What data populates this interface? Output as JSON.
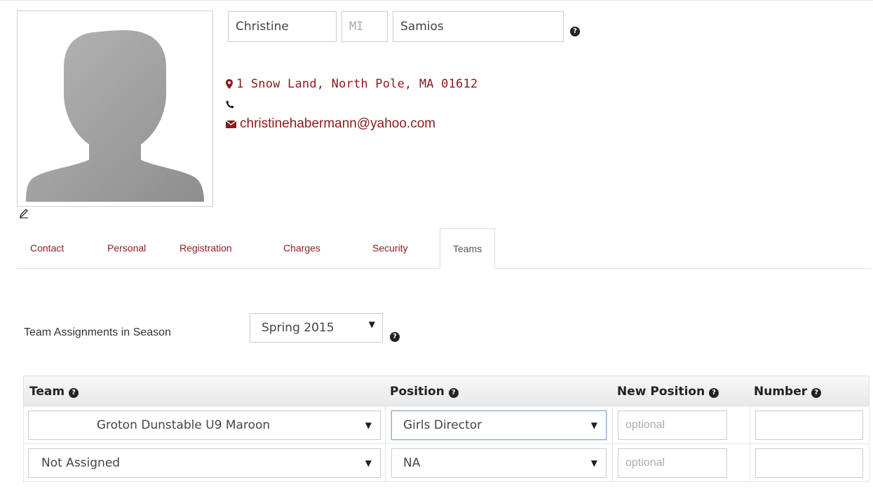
{
  "profile": {
    "first_name": "Christine",
    "middle_placeholder": "MI",
    "last_name": "Samios"
  },
  "contact": {
    "address": "1 Snow Land, North Pole, MA 01612",
    "phone": "",
    "email": "christinehabermann@yahoo.com"
  },
  "tabs": [
    {
      "label": "Contact"
    },
    {
      "label": "Personal"
    },
    {
      "label": "Registration"
    },
    {
      "label": "Charges"
    },
    {
      "label": "Security"
    },
    {
      "label": "Teams"
    }
  ],
  "active_tab": "Teams",
  "season": {
    "label": "Team Assignments in Season",
    "selected": "Spring 2015"
  },
  "table": {
    "headers": {
      "team": "Team",
      "position": "Position",
      "new_position": "New Position",
      "number": "Number"
    },
    "rows": [
      {
        "team": "Groton Dunstable U9 Maroon",
        "position": "Girls Director",
        "new_position_placeholder": "optional",
        "number": ""
      },
      {
        "team": "Not Assigned",
        "position": "NA",
        "new_position_placeholder": "optional",
        "number": ""
      }
    ]
  },
  "colors": {
    "link": "#8b1a1a",
    "help_icon": "#222222",
    "focus_border": "#7fa5d8"
  },
  "icons": [
    "avatar-placeholder-icon",
    "pencil-icon",
    "help-icon",
    "map-marker-icon",
    "phone-icon",
    "envelope-icon",
    "dropdown-caret-icon"
  ]
}
